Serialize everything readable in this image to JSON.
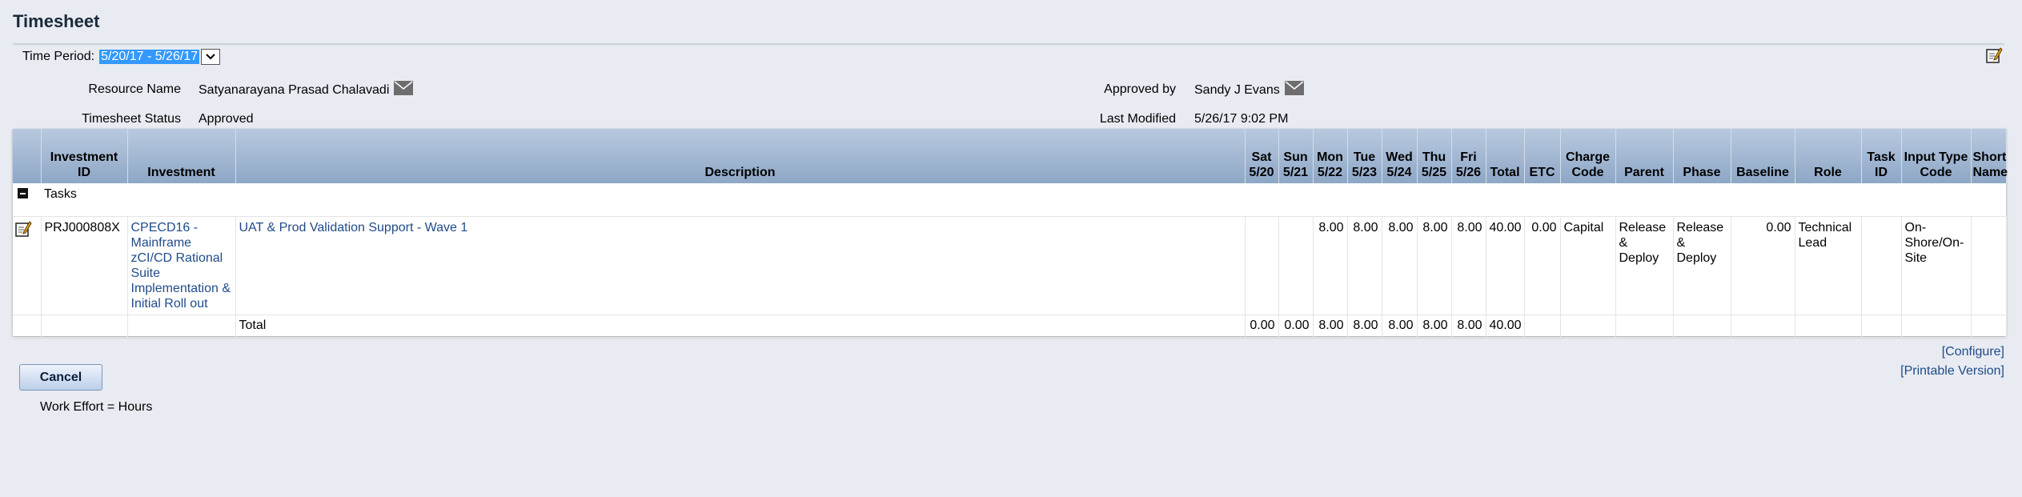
{
  "page": {
    "title": "Timesheet"
  },
  "time_period": {
    "label": "Time Period:",
    "value": "5/20/17 - 5/26/17"
  },
  "info": {
    "resource_name_label": "Resource Name",
    "resource_name": "Satyanarayana Prasad Chalavadi",
    "status_label": "Timesheet Status",
    "status": "Approved",
    "approved_by_label": "Approved by",
    "approved_by": "Sandy J Evans",
    "last_modified_label": "Last Modified",
    "last_modified": "5/26/17 9:02 PM"
  },
  "table": {
    "headers": {
      "investment_id": "Investment ID",
      "investment": "Investment",
      "description": "Description",
      "sat": "Sat 5/20",
      "sun": "Sun 5/21",
      "mon": "Mon 5/22",
      "tue": "Tue 5/23",
      "wed": "Wed 5/24",
      "thu": "Thu 5/25",
      "fri": "Fri 5/26",
      "total": "Total",
      "etc": "ETC",
      "charge_code": "Charge Code",
      "parent": "Parent",
      "phase": "Phase",
      "baseline": "Baseline",
      "role": "Role",
      "task_id": "Task ID",
      "input_type_code": "Input Type Code",
      "short_name": "Short Name"
    },
    "group_label": "Tasks",
    "row": {
      "investment_id": "PRJ000808X",
      "investment": "CPECD16 - Mainframe zCI/CD Rational Suite Implementation & Initial Roll out",
      "description": "UAT & Prod Validation Support - Wave 1",
      "sat": "",
      "sun": "",
      "mon": "8.00",
      "tue": "8.00",
      "wed": "8.00",
      "thu": "8.00",
      "fri": "8.00",
      "total": "40.00",
      "etc": "0.00",
      "charge_code": "Capital",
      "parent": "Release & Deploy",
      "phase": "Release & Deploy",
      "baseline": "0.00",
      "role": "Technical Lead",
      "task_id": "",
      "input_type_code": "On-Shore/On-Site",
      "short_name": ""
    },
    "totals": {
      "label": "Total",
      "sat": "0.00",
      "sun": "0.00",
      "mon": "8.00",
      "tue": "8.00",
      "wed": "8.00",
      "thu": "8.00",
      "fri": "8.00",
      "total": "40.00"
    }
  },
  "links": {
    "configure": "[Configure]",
    "printable": "[Printable Version]"
  },
  "buttons": {
    "cancel": "Cancel"
  },
  "footer": {
    "work_effort": "Work Effort = Hours"
  },
  "icons": {
    "edit": "edit-note-icon",
    "mail": "envelope-icon",
    "collapse": "collapse-minus-icon",
    "dropdown": "chevron-down-icon"
  },
  "colors": {
    "link": "#1f4b88",
    "header_bg": "#a3b8d3",
    "selection": "#3399ff",
    "page_bg": "#e8ebf2"
  }
}
